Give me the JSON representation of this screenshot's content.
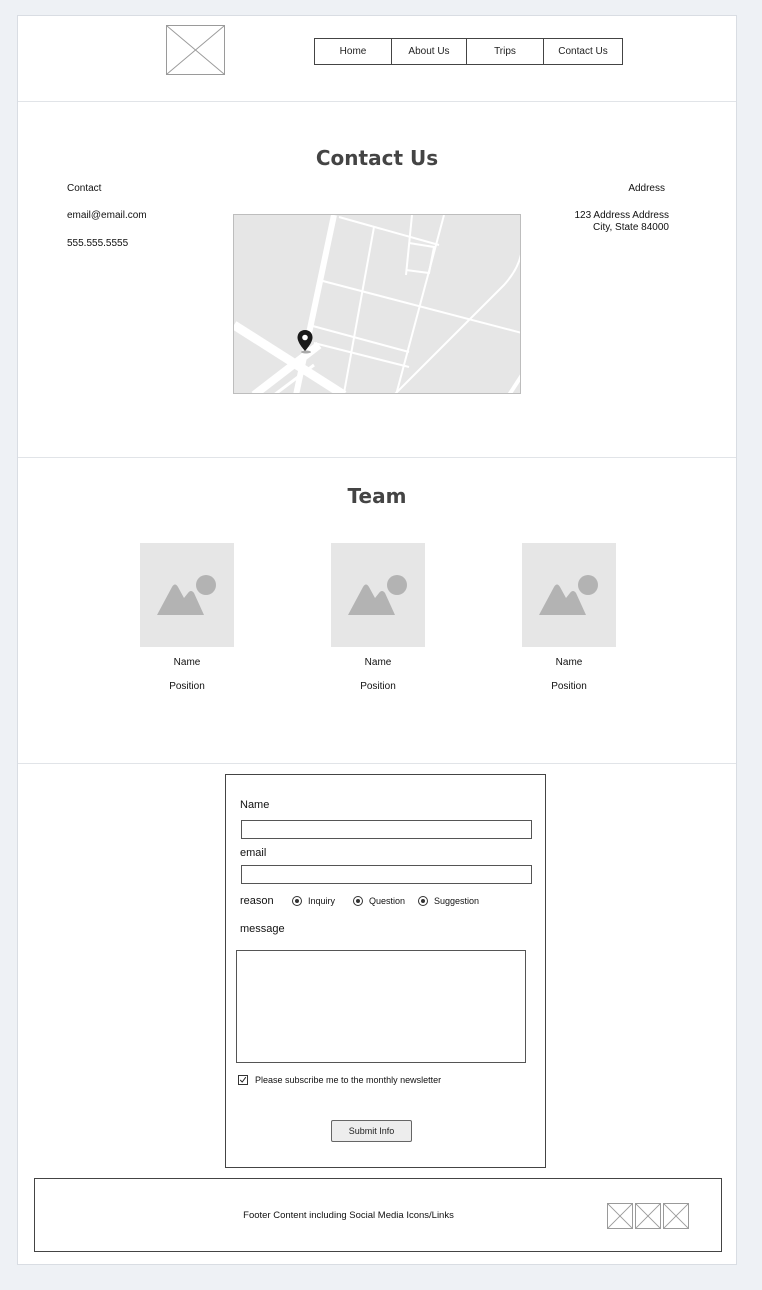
{
  "nav": {
    "items": [
      "Home",
      "About Us",
      "Trips",
      "Contact Us"
    ]
  },
  "contact_section": {
    "title": "Contact Us",
    "left": {
      "heading": "Contact",
      "email": "email@email.com",
      "phone": "555.555.5555"
    },
    "right": {
      "heading": "Address",
      "line1": "123 Address Address",
      "line2": "City, State 84000"
    }
  },
  "team": {
    "title": "Team",
    "members": [
      {
        "name": "Name",
        "position": "Position"
      },
      {
        "name": "Name",
        "position": "Position"
      },
      {
        "name": "Name",
        "position": "Position"
      }
    ]
  },
  "form": {
    "name_label": "Name",
    "name_value": "",
    "email_label": "email",
    "email_value": "",
    "reason_label": "reason",
    "reason_options": [
      "Inquiry",
      "Question",
      "Suggestion"
    ],
    "message_label": "message",
    "message_value": "",
    "newsletter_label": "Please subscribe me to the monthly newsletter",
    "newsletter_checked": true,
    "submit_label": "Submit Info"
  },
  "footer": {
    "text": "Footer Content including Social Media Icons/Links"
  },
  "icons": {
    "logo": "image-placeholder-icon",
    "map_pin": "map-pin-icon",
    "photo": "image-icon",
    "social": [
      "social-icon",
      "social-icon",
      "social-icon"
    ]
  }
}
